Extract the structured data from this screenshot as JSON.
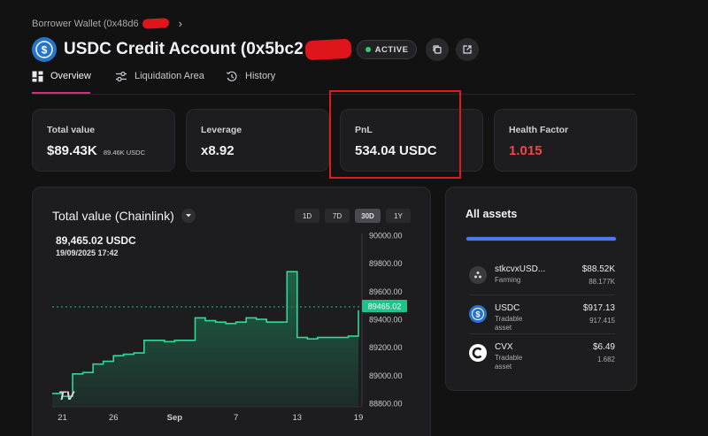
{
  "breadcrumb": {
    "label": "Borrower Wallet (0x48d6"
  },
  "header": {
    "title": "USDC Credit Account (0x5bc2",
    "status": "ACTIVE"
  },
  "tabs": [
    {
      "label": "Overview",
      "icon": "grid-icon",
      "active": true
    },
    {
      "label": "Liquidation Area",
      "icon": "sliders-icon"
    },
    {
      "label": "History",
      "icon": "history-icon"
    }
  ],
  "stats": [
    {
      "label": "Total value",
      "value": "$89.43K",
      "sub": "89.46K USDC"
    },
    {
      "label": "Leverage",
      "value": "x8.92"
    },
    {
      "label": "PnL",
      "value": "534.04 USDC"
    },
    {
      "label": "Health Factor",
      "value": "1.015",
      "color": "#f04646"
    }
  ],
  "chart": {
    "title": "Total value (Chainlink)",
    "ranges": [
      "1D",
      "7D",
      "30D",
      "1Y"
    ],
    "selected_range": "30D",
    "tooltip_value": "89,465.02 USDC",
    "tooltip_date": "19/09/2025 17:42",
    "last_label": "89465.02",
    "watermark": "TV"
  },
  "chart_data": {
    "type": "area",
    "x": [
      "Aug 20",
      "Aug 21",
      "Aug 22",
      "Aug 23",
      "Aug 24",
      "Aug 25",
      "Aug 26",
      "Aug 27",
      "Aug 28",
      "Aug 29",
      "Aug 30",
      "Aug 31",
      "Sep 1",
      "Sep 2",
      "Sep 3",
      "Sep 4",
      "Sep 5",
      "Sep 6",
      "Sep 7",
      "Sep 8",
      "Sep 9",
      "Sep 10",
      "Sep 11",
      "Sep 12",
      "Sep 13",
      "Sep 14",
      "Sep 15",
      "Sep 16",
      "Sep 17",
      "Sep 18",
      "Sep 19"
    ],
    "values": [
      88870,
      88850,
      89010,
      89020,
      89080,
      89100,
      89140,
      89150,
      89160,
      89250,
      89250,
      89240,
      89250,
      89250,
      89410,
      89390,
      89380,
      89370,
      89380,
      89410,
      89400,
      89380,
      89380,
      89740,
      89270,
      89260,
      89270,
      89270,
      89270,
      89280,
      89465.02
    ],
    "x_tick_labels": [
      "21",
      "26",
      "Sep",
      "7",
      "13",
      "19"
    ],
    "y_tick_labels": [
      "90000.00",
      "89800.00",
      "89600.00",
      "89400.00",
      "89200.00",
      "89000.00",
      "88800.00"
    ],
    "ylim": [
      88775,
      90000
    ],
    "color": "#22c08a"
  },
  "assets": {
    "title": "All assets",
    "items": [
      {
        "name": "stkcvxUSD...",
        "type": "Farming",
        "usd": "$88.52K",
        "amount": "88.177K",
        "icon": "stkcvx-icon"
      },
      {
        "name": "USDC",
        "type": "Tradable asset",
        "usd": "$917.13",
        "amount": "917.415",
        "icon": "usdc-icon"
      },
      {
        "name": "CVX",
        "type": "Tradable asset",
        "usd": "$6.49",
        "amount": "1.682",
        "icon": "cvx-icon"
      }
    ]
  }
}
